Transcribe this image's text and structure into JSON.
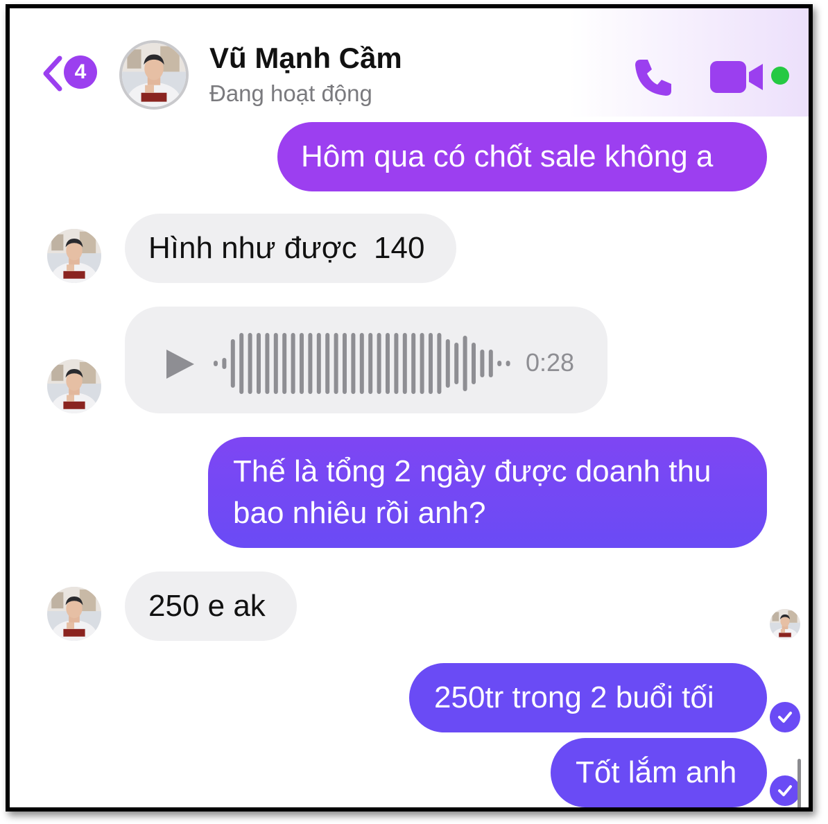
{
  "header": {
    "unread_count": "4",
    "contact_name": "Vũ Mạnh Cầm",
    "contact_status": "Đang hoạt động",
    "accent_color": "#9b3fef",
    "online_color": "#25c943",
    "icons": [
      "back-chevron-icon",
      "phone-icon",
      "video-camera-icon",
      "online-status-icon"
    ]
  },
  "messages": [
    {
      "direction": "outgoing",
      "text": "Hôm qua có chốt sale không a"
    },
    {
      "direction": "incoming",
      "text": "Hình như được  140"
    },
    {
      "direction": "incoming",
      "type": "voice",
      "duration": "0:28"
    },
    {
      "direction": "outgoing",
      "lines": [
        "Thế là tổng 2 ngày được doanh thu",
        "bao nhiêu rồi anh?"
      ]
    },
    {
      "direction": "incoming",
      "text": "250 e ak"
    },
    {
      "direction": "outgoing",
      "text": "250tr trong 2 buổi tối",
      "status": "seen"
    },
    {
      "direction": "outgoing",
      "text": "Tốt lắm anh",
      "status": "seen"
    }
  ],
  "colors": {
    "outgoing_top": "#9c3ff0",
    "outgoing_bottom": "#6a4bf5",
    "incoming_bg": "#efeff1"
  }
}
